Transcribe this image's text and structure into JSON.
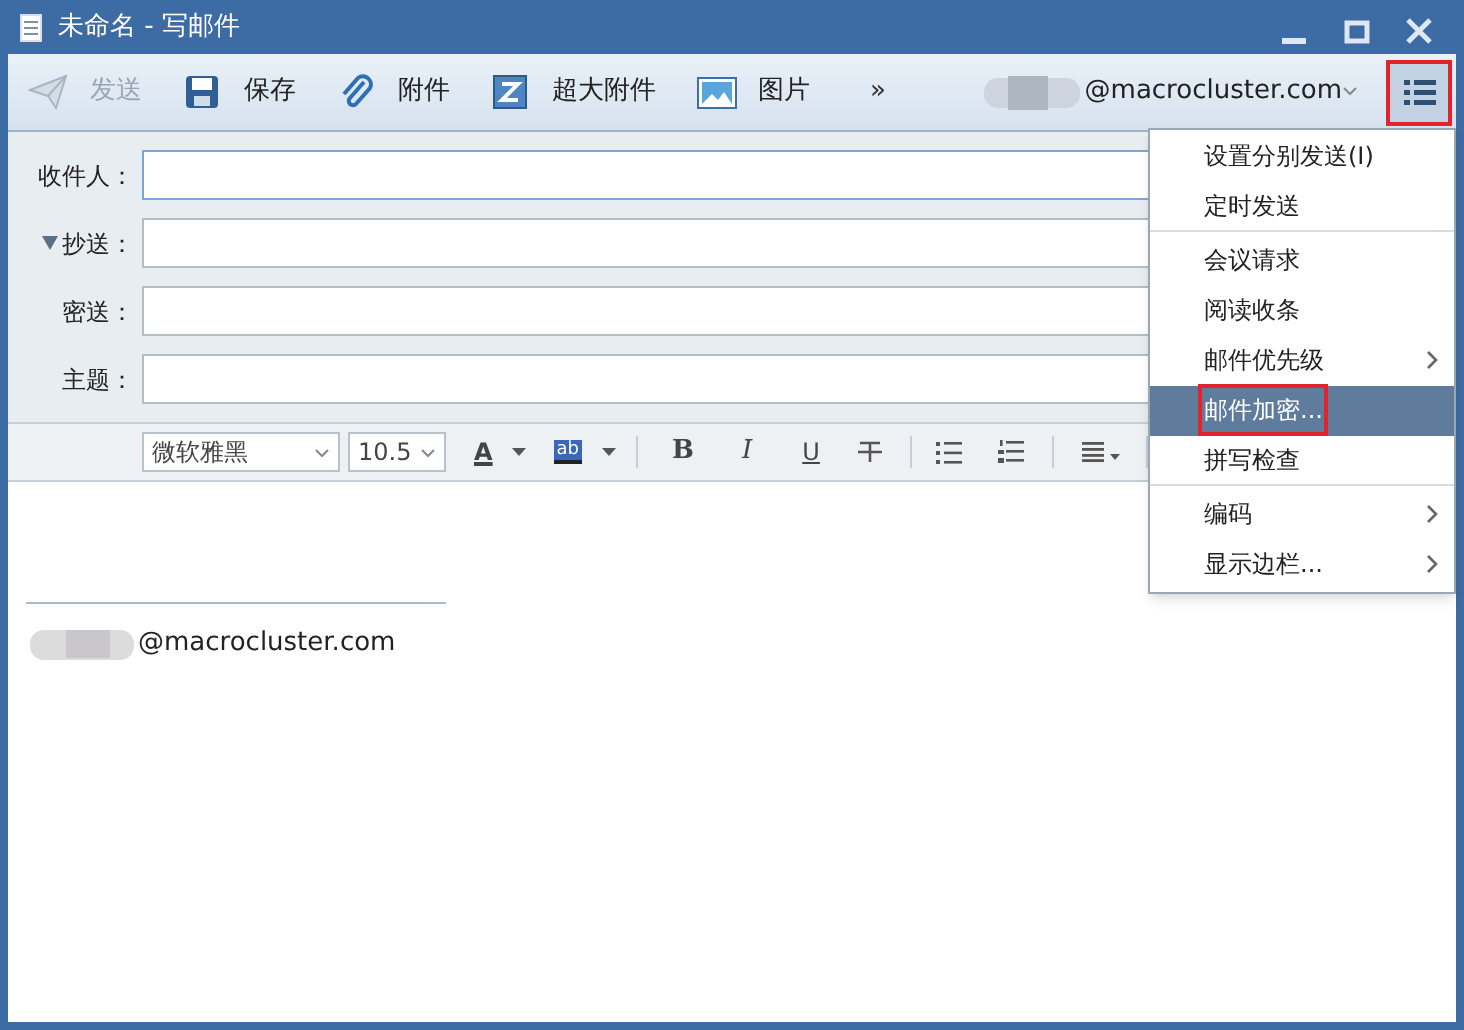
{
  "window": {
    "title": "未命名 - 写邮件"
  },
  "toolbar": {
    "buttons": [
      {
        "kind": "send",
        "label": "发送",
        "disabled": true
      },
      {
        "kind": "save",
        "label": "保存",
        "disabled": false
      },
      {
        "kind": "attach",
        "label": "附件",
        "disabled": false
      },
      {
        "kind": "large",
        "label": "超大附件",
        "disabled": false
      },
      {
        "kind": "image",
        "label": "图片",
        "disabled": false
      }
    ],
    "overflow": "»",
    "account": "@macrocluster.com",
    "menu_button_highlighted": true
  },
  "fields": [
    {
      "label": "收件人：",
      "focused": true,
      "expander": false
    },
    {
      "label": "抄送：",
      "focused": false,
      "expander": true
    },
    {
      "label": "密送：",
      "focused": false,
      "expander": false
    },
    {
      "label": "主题：",
      "focused": false,
      "expander": false
    }
  ],
  "format": {
    "font": "微软雅黑",
    "size": "10.5",
    "font_color": "A",
    "highlight": "ab",
    "bold": "B",
    "italic": "I",
    "underline": "U"
  },
  "body": {
    "signature": "@macrocluster.com"
  },
  "menu": {
    "items": [
      {
        "label": "设置分别发送(I)",
        "submenu": false,
        "selected": false,
        "highlighted": false,
        "separator_after": false
      },
      {
        "label": "定时发送",
        "submenu": false,
        "selected": false,
        "highlighted": false,
        "separator_after": true
      },
      {
        "label": "会议请求",
        "submenu": false,
        "selected": false,
        "highlighted": false,
        "separator_after": false
      },
      {
        "label": "阅读收条",
        "submenu": false,
        "selected": false,
        "highlighted": false,
        "separator_after": false
      },
      {
        "label": "邮件优先级",
        "submenu": true,
        "selected": false,
        "highlighted": false,
        "separator_after": false
      },
      {
        "label": "邮件加密...",
        "submenu": false,
        "selected": true,
        "highlighted": true,
        "separator_after": false
      },
      {
        "label": "拼写检查",
        "submenu": false,
        "selected": false,
        "highlighted": false,
        "separator_after": true
      },
      {
        "label": "编码",
        "submenu": true,
        "selected": false,
        "highlighted": false,
        "separator_after": false
      },
      {
        "label": "显示边栏...",
        "submenu": true,
        "selected": false,
        "highlighted": false,
        "separator_after": false
      }
    ]
  }
}
